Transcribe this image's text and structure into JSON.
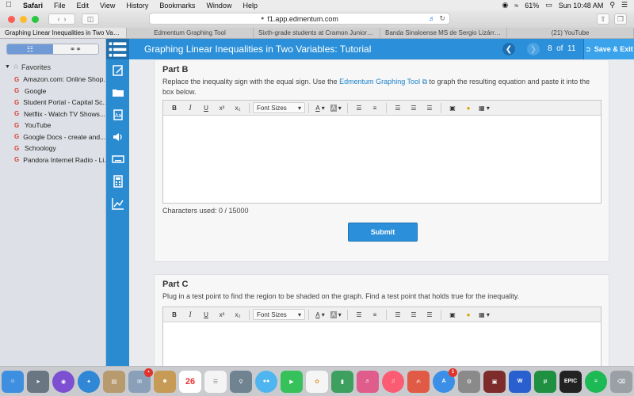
{
  "menubar": {
    "app": "Safari",
    "items": [
      "File",
      "Edit",
      "View",
      "History",
      "Bookmarks",
      "Window",
      "Help"
    ],
    "battery": "61%",
    "clock": "Sun 10:48 AM"
  },
  "browser": {
    "url": "f1.app.edmentum.com",
    "tabs": [
      "Graphing Linear Inequalities in Two Variables: Tu...",
      "Edmentum Graphing Tool",
      "Sixth-grade students at Cramon Junior High ar...",
      "Banda Sinaloense MS de Sergio Lizárraga Rad...",
      "(21) YouTube"
    ]
  },
  "bookmarks": {
    "section": "Favorites",
    "items": [
      "Amazon.com: Online Shop...",
      "Google",
      "Student Portal - Capital Sc...",
      "Netflix - Watch TV Shows...",
      "YouTube",
      "Google Docs - create and...",
      "Schoology",
      "Pandora Internet Radio - Li..."
    ]
  },
  "tutorial": {
    "title": "Graphing Linear Inequalities in Two Variables: Tutorial",
    "page_current": "8",
    "page_of": "of",
    "page_total": "11",
    "save_exit": "Save & Exit"
  },
  "part_b": {
    "heading": "Part B",
    "text_before": "Replace the inequality sign with the equal sign. Use the",
    "link": "Edmentum Graphing Tool",
    "text_after": "to graph the resulting equation and paste it into the box below.",
    "chars_used": "Characters used: 0 / 15000",
    "submit": "Submit"
  },
  "part_c": {
    "heading": "Part C",
    "text": "Plug in a test point to find the region to be shaded on the graph. Find a test point that holds true for the inequality."
  },
  "editor": {
    "bold": "B",
    "italic": "I",
    "underline": "U",
    "superscript": "x²",
    "subscript": "x₂",
    "font_sizes": "Font Sizes",
    "font_color": "A",
    "bg_color": "A"
  },
  "dock": {
    "calendar_day": "26",
    "badge_count": "1"
  },
  "colors": {
    "accent": "#2b90d9",
    "rail": "#2a8bd1",
    "link": "#1a82c9"
  }
}
